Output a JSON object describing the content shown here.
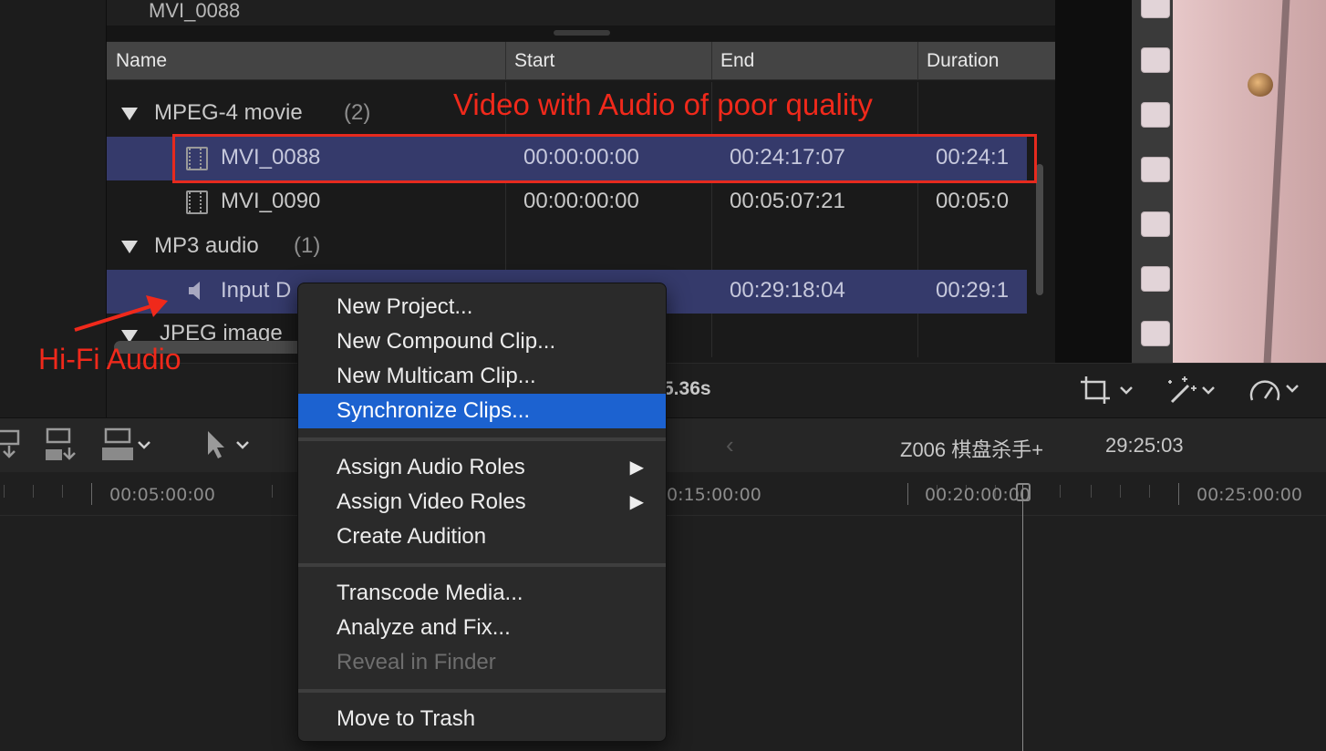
{
  "browser": {
    "top_clip": "MVI_0088",
    "columns": [
      "Name",
      "Start",
      "End",
      "Duration"
    ],
    "groups": [
      {
        "label": "MPEG-4 movie",
        "count": "(2)"
      },
      {
        "label": "MP3 audio",
        "count": "(1)"
      },
      {
        "label": "JPEG image"
      }
    ],
    "rows": [
      {
        "name": "MVI_0088",
        "start": "00:00:00:00",
        "end": "00:24:17:07",
        "duration": "00:24:1"
      },
      {
        "name": "MVI_0090",
        "start": "00:00:00:00",
        "end": "00:05:07:21",
        "duration": "00:05:0"
      },
      {
        "name": "Input D",
        "start": "",
        "end": "00:29:18:04",
        "duration": "00:29:1"
      }
    ],
    "status_text": "5.36s"
  },
  "timeline": {
    "project_name": "Z006 棋盘杀手+",
    "project_duration": "29:25:03",
    "ruler_labels": [
      "00:05:00:00",
      "0:15:00:00",
      "00:20:00:00",
      "00:25:00:00"
    ]
  },
  "context_menu": {
    "items": [
      {
        "label": "New Project..."
      },
      {
        "label": "New Compound Clip..."
      },
      {
        "label": "New Multicam Clip..."
      },
      {
        "label": "Synchronize Clips...",
        "highlighted": true
      },
      {
        "label": "Assign Audio Roles",
        "submenu": true
      },
      {
        "label": "Assign Video Roles",
        "submenu": true
      },
      {
        "label": "Create Audition"
      },
      {
        "label": "Transcode Media..."
      },
      {
        "label": "Analyze and Fix..."
      },
      {
        "label": "Reveal in Finder",
        "disabled": true
      },
      {
        "label": "Move to Trash"
      }
    ]
  },
  "annotations": {
    "video_note": "Video with  Audio of poor quality",
    "audio_note": "Hi-Fi  Audio"
  },
  "colors": {
    "selection": "#353a6b",
    "menu_highlight": "#1c62d0",
    "annotation": "#f0291b"
  },
  "icons": [
    "film-clip-icon",
    "speaker-icon",
    "crop-icon",
    "magic-wand-icon",
    "speedometer-icon",
    "select-arrow-icon",
    "back-arrow-icon"
  ]
}
